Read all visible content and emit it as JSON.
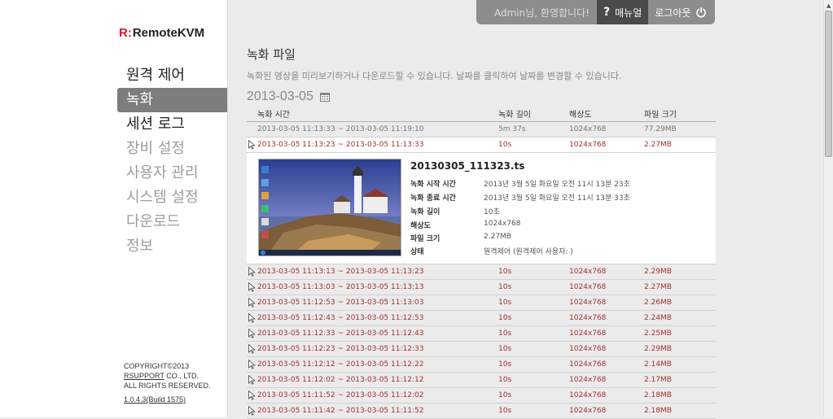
{
  "brand": {
    "logo_mark": "R:",
    "logo_text": "RemoteKVM"
  },
  "sidebar": {
    "items": [
      {
        "label": "원격 제어",
        "state": "normal"
      },
      {
        "label": "녹화",
        "state": "active"
      },
      {
        "label": "세션 로그",
        "state": "normal"
      },
      {
        "label": "장비 설정",
        "state": "dim"
      },
      {
        "label": "사용자 관리",
        "state": "dim"
      },
      {
        "label": "시스템 설정",
        "state": "dim"
      },
      {
        "label": "다운로드",
        "state": "dim"
      },
      {
        "label": "정보",
        "state": "dim"
      }
    ],
    "copyright_line1": "COPYRIGHT©2013",
    "copyright_company": "RSUPPORT",
    "copyright_company_suffix": " CO., LTD.",
    "copyright_line3": "ALL RIGHTS RESERVED.",
    "version": "1.0.4.3(Build 1575)"
  },
  "topbar": {
    "welcome": "Admin님, 환영합니다!",
    "manual_icon": "?",
    "manual_label": "매뉴얼",
    "logout_label": "로그아웃",
    "logout_icon": "power-icon"
  },
  "main": {
    "title": "녹화 파일",
    "description": "녹화된 영상을 미리보기하거나 다운로드할 수 있습니다. 날짜를 클릭하여 날짜를 변경할 수 있습니다.",
    "date": "2013-03-05",
    "date_icon": "calendar-icon"
  },
  "table": {
    "headers": {
      "time": "녹화 시간",
      "length": "녹화 길이",
      "resolution": "해상도",
      "size": "파일 크기"
    },
    "rows": [
      {
        "time": "2013-03-05 11:13:33 ~ 2013-03-05 11:19:10",
        "length": "5m 37s",
        "resolution": "1024x768",
        "size": "77.29MB"
      },
      {
        "time": "2013-03-05 11:13:23 ~ 2013-03-05 11:13:33",
        "length": "10s",
        "resolution": "1024x768",
        "size": "2.27MB"
      },
      {
        "time": "2013-03-05 11:13:13 ~ 2013-03-05 11:13:23",
        "length": "10s",
        "resolution": "1024x768",
        "size": "2.29MB"
      },
      {
        "time": "2013-03-05 11:13:03 ~ 2013-03-05 11:13:13",
        "length": "10s",
        "resolution": "1024x768",
        "size": "2.27MB"
      },
      {
        "time": "2013-03-05 11:12:53 ~ 2013-03-05 11:13:03",
        "length": "10s",
        "resolution": "1024x768",
        "size": "2.26MB"
      },
      {
        "time": "2013-03-05 11:12:43 ~ 2013-03-05 11:12:53",
        "length": "10s",
        "resolution": "1024x768",
        "size": "2.24MB"
      },
      {
        "time": "2013-03-05 11:12:33 ~ 2013-03-05 11:12:43",
        "length": "10s",
        "resolution": "1024x768",
        "size": "2.25MB"
      },
      {
        "time": "2013-03-05 11:12:23 ~ 2013-03-05 11:12:33",
        "length": "10s",
        "resolution": "1024x768",
        "size": "2.29MB"
      },
      {
        "time": "2013-03-05 11:12:12 ~ 2013-03-05 11:12:22",
        "length": "10s",
        "resolution": "1024x768",
        "size": "2.14MB"
      },
      {
        "time": "2013-03-05 11:12:02 ~ 2013-03-05 11:12:12",
        "length": "10s",
        "resolution": "1024x768",
        "size": "2.17MB"
      },
      {
        "time": "2013-03-05 11:11:52 ~ 2013-03-05 11:12:02",
        "length": "10s",
        "resolution": "1024x768",
        "size": "2.18MB"
      },
      {
        "time": "2013-03-05 11:11:42 ~ 2013-03-05 11:11:52",
        "length": "10s",
        "resolution": "1024x768",
        "size": "2.18MB"
      }
    ]
  },
  "detail": {
    "filename": "20130305_111323.ts",
    "fields": [
      {
        "label": "녹화 시작 시간",
        "value": "2013년 3월 5일 화요일 오전 11시 13분 23초"
      },
      {
        "label": "녹화 종료 시간",
        "value": "2013년 3월 5일 화요일 오전 11시 13분 33초"
      },
      {
        "label": "녹화 길이",
        "value": "10초"
      },
      {
        "label": "해상도",
        "value": "1024x768"
      },
      {
        "label": "파일 크기",
        "value": "2.27MB"
      },
      {
        "label": "상태",
        "value": "원격제어 (원격제어 사용자: )"
      }
    ]
  }
}
